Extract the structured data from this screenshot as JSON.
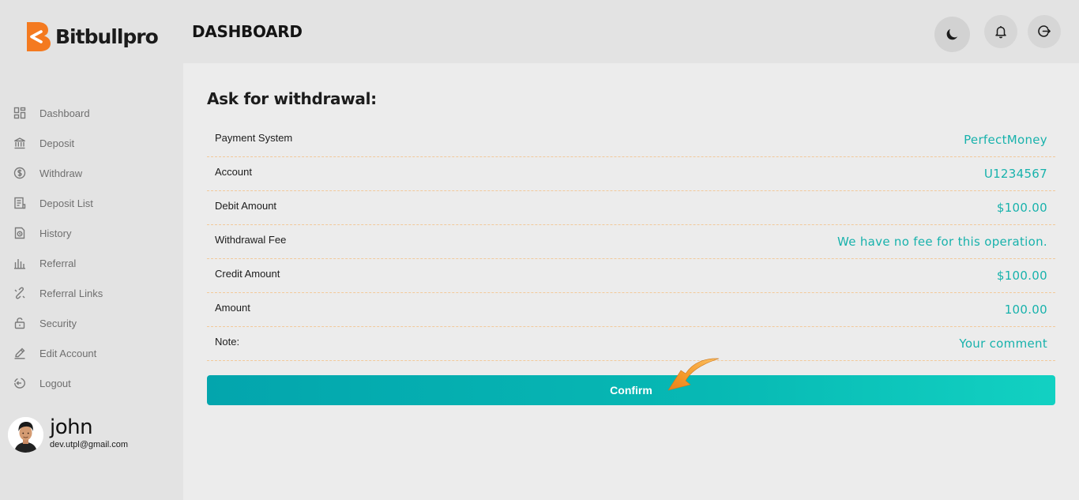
{
  "brand": {
    "name": "Bitbullpro",
    "accent": "#f47a20"
  },
  "header": {
    "title": "DASHBOARD",
    "buttons": [
      {
        "icon": "moon-icon"
      },
      {
        "icon": "bell-icon"
      },
      {
        "icon": "logout-icon"
      }
    ]
  },
  "sidebar": {
    "items": [
      {
        "label": "Dashboard",
        "icon": "dashboard-icon"
      },
      {
        "label": "Deposit",
        "icon": "bank-icon"
      },
      {
        "label": "Withdraw",
        "icon": "dollar-circle-icon"
      },
      {
        "label": "Deposit List",
        "icon": "list-document-icon"
      },
      {
        "label": "History",
        "icon": "history-document-icon"
      },
      {
        "label": "Referral",
        "icon": "bar-chart-icon"
      },
      {
        "label": "Referral Links",
        "icon": "link-icon"
      },
      {
        "label": "Security",
        "icon": "lock-icon"
      },
      {
        "label": "Edit Account",
        "icon": "pencil-icon"
      },
      {
        "label": "Logout",
        "icon": "logout-icon"
      }
    ]
  },
  "user": {
    "name": "john",
    "email": "dev.utpl@gmail.com"
  },
  "main": {
    "title": "Ask for withdrawal:",
    "rows": [
      {
        "label": "Payment System",
        "value": "PerfectMoney"
      },
      {
        "label": "Account",
        "value": "U1234567"
      },
      {
        "label": "Debit Amount",
        "value": "$100.00"
      },
      {
        "label": "Withdrawal Fee",
        "value": "We have no fee for this operation."
      },
      {
        "label": "Credit Amount",
        "value": "$100.00"
      },
      {
        "label": "Amount",
        "value": "100.00"
      },
      {
        "label": "Note:",
        "value": "Your comment"
      }
    ],
    "confirm_label": "Confirm"
  },
  "colors": {
    "value_teal": "#18b2ac",
    "button_start": "#03a5ad",
    "button_end": "#12d1c2",
    "row_divider": "#f2c99a"
  }
}
